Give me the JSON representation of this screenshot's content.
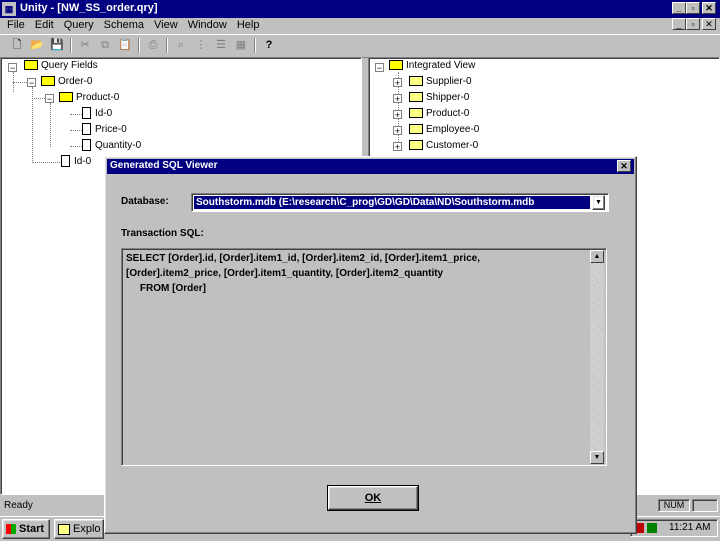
{
  "app": {
    "title": "Unity - [NW_SS_order.qry]",
    "icon": "unity-app-icon"
  },
  "menu": [
    "File",
    "Edit",
    "Query",
    "Schema",
    "View",
    "Window",
    "Help"
  ],
  "toolbar": {
    "icons": [
      "new-file-icon",
      "open-folder-icon",
      "save-icon",
      "cut-icon",
      "copy-icon",
      "paste-icon",
      "print-icon",
      "find-icon",
      "tree-icon",
      "list-icon",
      "table-icon",
      "help-icon"
    ]
  },
  "left_tree": {
    "root": "Query Fields",
    "order": "Order-0",
    "product": "Product-0",
    "fields": [
      "Id-0",
      "Price-0",
      "Quantity-0"
    ],
    "id": "Id-0"
  },
  "right_tree": {
    "root": "Integrated View",
    "items": [
      "Supplier-0",
      "Shipper-0",
      "Product-0",
      "Employee-0",
      "Customer-0"
    ]
  },
  "dialog": {
    "title": "Generated SQL Viewer",
    "database_label": "Database:",
    "database_value": "Southstorm.mdb (E:\\research\\C_prog\\GD\\GD\\Data\\ND\\Southstorm.mdb",
    "sql_label": "Transaction SQL:",
    "sql_lines": [
      "SELECT [Order].id, [Order].item1_id, [Order].item2_id, [Order].item1_price,",
      "[Order].item2_price, [Order].item1_quantity, [Order].item2_quantity",
      "     FROM [Order]"
    ],
    "ok_label": "OK"
  },
  "status": {
    "text": "Ready",
    "num": "NUM"
  },
  "taskbar": {
    "start": "Start",
    "task": "Explo",
    "clock": "11:21 AM"
  }
}
